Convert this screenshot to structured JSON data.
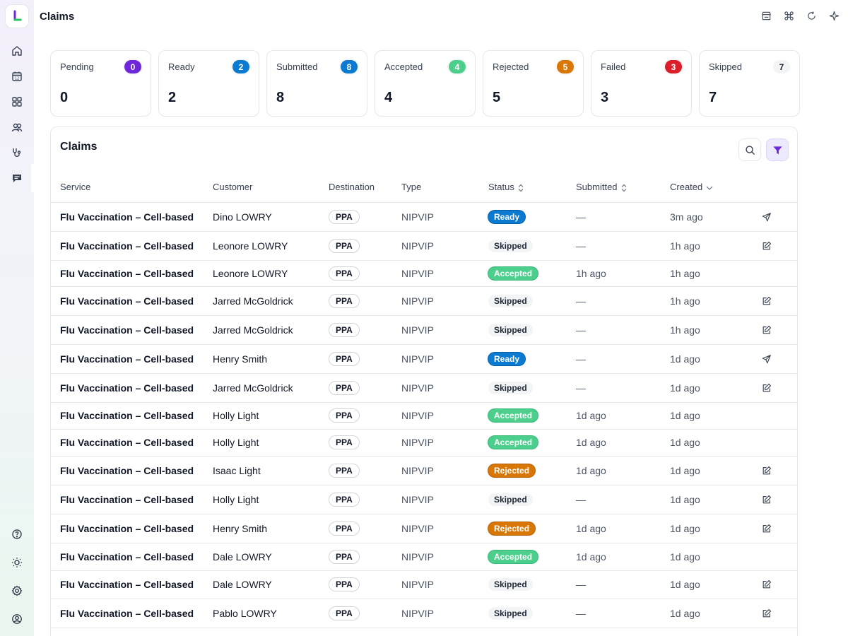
{
  "header": {
    "title": "Claims"
  },
  "colors": {
    "pending": "#6d28d9",
    "ready": "#0a7bd1",
    "submitted": "#0a7bd1",
    "accepted": "#4ccf8d",
    "rejected": "#d97706",
    "failed": "#dc1d2a",
    "skipped": "#f3f4f6"
  },
  "stats": [
    {
      "label": "Pending",
      "count": "0",
      "value": "0"
    },
    {
      "label": "Ready",
      "count": "2",
      "value": "2"
    },
    {
      "label": "Submitted",
      "count": "8",
      "value": "8"
    },
    {
      "label": "Accepted",
      "count": "4",
      "value": "4"
    },
    {
      "label": "Rejected",
      "count": "5",
      "value": "5"
    },
    {
      "label": "Failed",
      "count": "3",
      "value": "3"
    },
    {
      "label": "Skipped",
      "count": "7",
      "value": "7"
    }
  ],
  "table": {
    "title": "Claims",
    "columns": {
      "service": "Service",
      "customer": "Customer",
      "destination": "Destination",
      "type": "Type",
      "status": "Status",
      "submitted": "Submitted",
      "created": "Created"
    },
    "rows": [
      {
        "service": "Flu Vaccination – Cell-based",
        "customer": "Dino LOWRY",
        "destination": "PPA",
        "type": "NIPVIP",
        "status": "Ready",
        "submitted": "—",
        "created": "3m ago",
        "action": "send-icon"
      },
      {
        "service": "Flu Vaccination – Cell-based",
        "customer": "Leonore LOWRY",
        "destination": "PPA",
        "type": "NIPVIP",
        "status": "Skipped",
        "submitted": "—",
        "created": "1h ago",
        "action": "edit-icon"
      },
      {
        "service": "Flu Vaccination – Cell-based",
        "customer": "Leonore LOWRY",
        "destination": "PPA",
        "type": "NIPVIP",
        "status": "Accepted",
        "submitted": "1h ago",
        "created": "1h ago",
        "action": ""
      },
      {
        "service": "Flu Vaccination – Cell-based",
        "customer": "Jarred McGoldrick",
        "destination": "PPA",
        "type": "NIPVIP",
        "status": "Skipped",
        "submitted": "—",
        "created": "1h ago",
        "action": "edit-icon"
      },
      {
        "service": "Flu Vaccination – Cell-based",
        "customer": "Jarred McGoldrick",
        "destination": "PPA",
        "type": "NIPVIP",
        "status": "Skipped",
        "submitted": "—",
        "created": "1h ago",
        "action": "edit-icon"
      },
      {
        "service": "Flu Vaccination – Cell-based",
        "customer": "Henry Smith",
        "destination": "PPA",
        "type": "NIPVIP",
        "status": "Ready",
        "submitted": "—",
        "created": "1d ago",
        "action": "send-icon"
      },
      {
        "service": "Flu Vaccination – Cell-based",
        "customer": "Jarred McGoldrick",
        "destination": "PPA",
        "type": "NIPVIP",
        "status": "Skipped",
        "submitted": "—",
        "created": "1d ago",
        "action": "edit-icon"
      },
      {
        "service": "Flu Vaccination – Cell-based",
        "customer": "Holly Light",
        "destination": "PPA",
        "type": "NIPVIP",
        "status": "Accepted",
        "submitted": "1d ago",
        "created": "1d ago",
        "action": ""
      },
      {
        "service": "Flu Vaccination – Cell-based",
        "customer": "Holly Light",
        "destination": "PPA",
        "type": "NIPVIP",
        "status": "Accepted",
        "submitted": "1d ago",
        "created": "1d ago",
        "action": ""
      },
      {
        "service": "Flu Vaccination – Cell-based",
        "customer": "Isaac Light",
        "destination": "PPA",
        "type": "NIPVIP",
        "status": "Rejected",
        "submitted": "1d ago",
        "created": "1d ago",
        "action": "edit-icon"
      },
      {
        "service": "Flu Vaccination – Cell-based",
        "customer": "Holly Light",
        "destination": "PPA",
        "type": "NIPVIP",
        "status": "Skipped",
        "submitted": "—",
        "created": "1d ago",
        "action": "edit-icon"
      },
      {
        "service": "Flu Vaccination – Cell-based",
        "customer": "Henry Smith",
        "destination": "PPA",
        "type": "NIPVIP",
        "status": "Rejected",
        "submitted": "1d ago",
        "created": "1d ago",
        "action": "edit-icon"
      },
      {
        "service": "Flu Vaccination – Cell-based",
        "customer": "Dale LOWRY",
        "destination": "PPA",
        "type": "NIPVIP",
        "status": "Accepted",
        "submitted": "1d ago",
        "created": "1d ago",
        "action": ""
      },
      {
        "service": "Flu Vaccination – Cell-based",
        "customer": "Dale LOWRY",
        "destination": "PPA",
        "type": "NIPVIP",
        "status": "Skipped",
        "submitted": "—",
        "created": "1d ago",
        "action": "edit-icon"
      },
      {
        "service": "Flu Vaccination – Cell-based",
        "customer": "Pablo LOWRY",
        "destination": "PPA",
        "type": "NIPVIP",
        "status": "Skipped",
        "submitted": "—",
        "created": "1d ago",
        "action": "edit-icon"
      }
    ]
  }
}
